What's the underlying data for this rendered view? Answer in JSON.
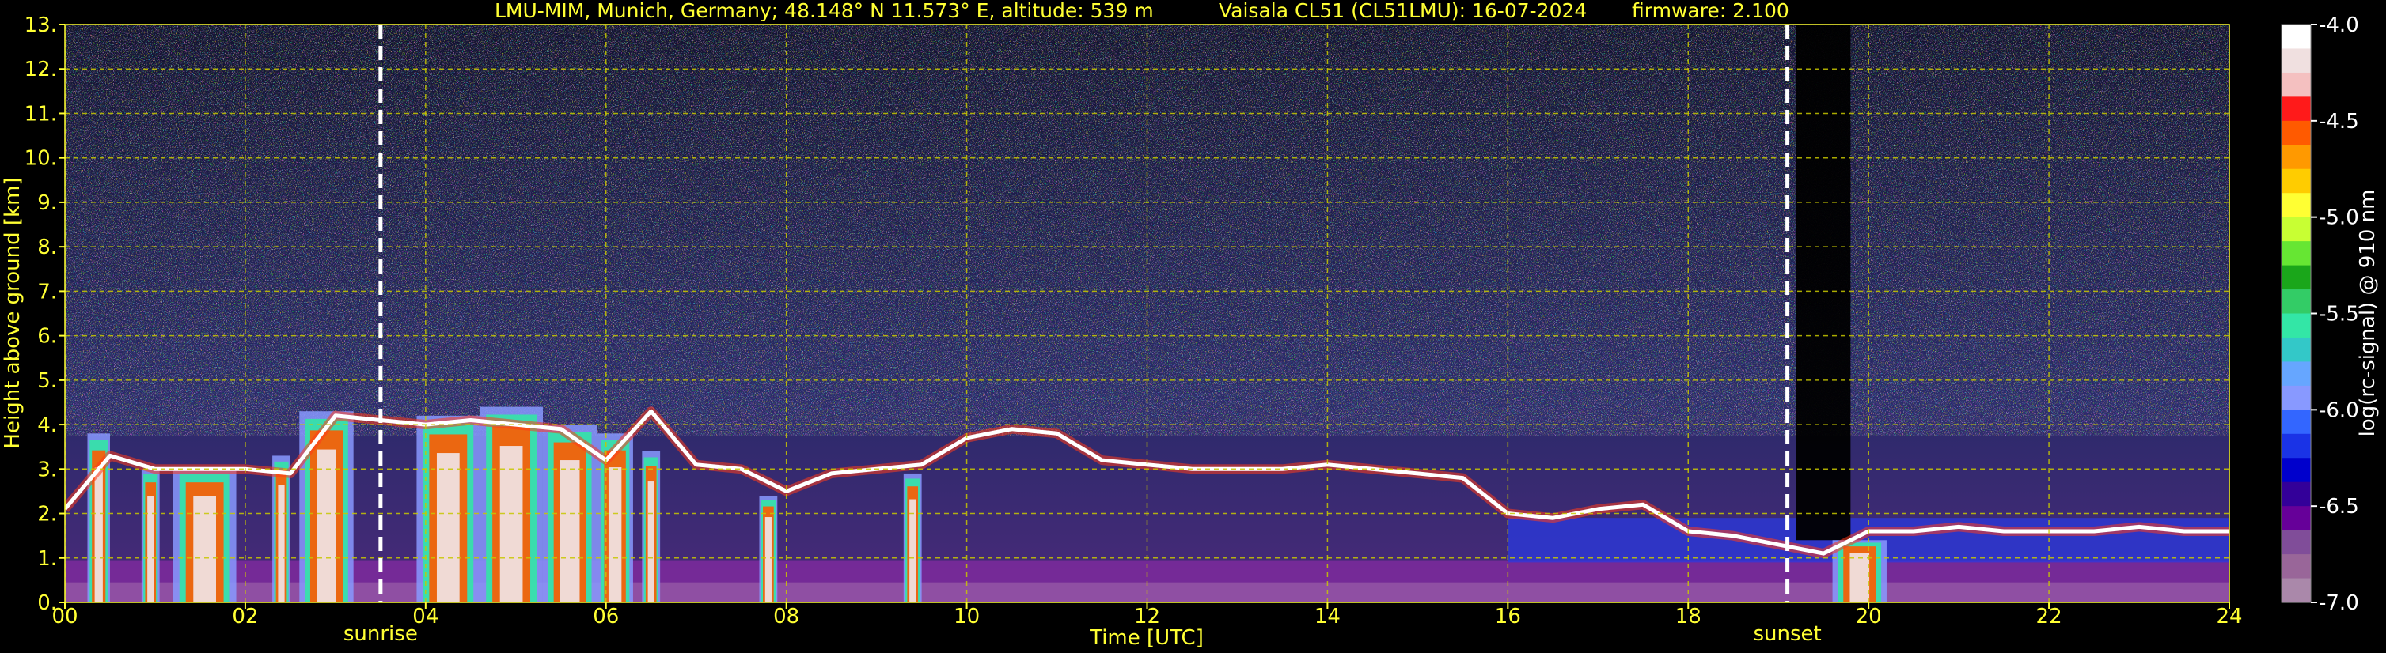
{
  "header": {
    "site": "LMU-MIM, Munich, Germany; 48.148° N 11.573° E, altitude: 539 m",
    "instrument": "Vaisala CL51 (CL51LMU): 16-07-2024",
    "firmware": "firmware: 2.100"
  },
  "colors": {
    "text": "#ffff33",
    "grid": "#c8c800",
    "background": "#000000",
    "marker": "#ffffff"
  },
  "chart_data": {
    "type": "heatmap",
    "title": "",
    "xlabel": "Time [UTC]",
    "ylabel": "Height above ground [km]",
    "xlim": [
      0,
      24
    ],
    "ylim": [
      0,
      13
    ],
    "x_ticks": [
      "00",
      "02",
      "04",
      "06",
      "08",
      "10",
      "12",
      "14",
      "16",
      "18",
      "20",
      "22",
      "24"
    ],
    "x_tick_values": [
      0,
      2,
      4,
      6,
      8,
      10,
      12,
      14,
      16,
      18,
      20,
      22,
      24
    ],
    "y_ticks": [
      "0.",
      "1.",
      "2.",
      "3.",
      "4.",
      "5.",
      "6.",
      "7.",
      "8.",
      "9.",
      "10.",
      "11.",
      "12.",
      "13."
    ],
    "y_tick_values": [
      0,
      1,
      2,
      3,
      4,
      5,
      6,
      7,
      8,
      9,
      10,
      11,
      12,
      13
    ],
    "grid": true,
    "annotations": [
      {
        "label": "sunrise",
        "x": 3.5
      },
      {
        "label": "sunset",
        "x": 19.1
      }
    ],
    "colorbar": {
      "label": "log(rc-signal) @ 910 nm",
      "range": [
        -7.0,
        -4.0
      ],
      "ticks": [
        "-4.0",
        "-4.5",
        "-5.0",
        "-5.5",
        "-6.0",
        "-6.5",
        "-7.0"
      ],
      "tick_values": [
        -4.0,
        -4.5,
        -5.0,
        -5.5,
        -6.0,
        -6.5,
        -7.0
      ],
      "colors": [
        "#ffffff",
        "#f0e0e0",
        "#f4c0c0",
        "#ff1a1a",
        "#ff5a00",
        "#ff9900",
        "#ffcc00",
        "#ffff33",
        "#c8ff33",
        "#66e633",
        "#1aa61a",
        "#33cc66",
        "#33e6a6",
        "#33c8c8",
        "#66a6ff",
        "#8899ff",
        "#3366ff",
        "#1a33e6",
        "#0000cc",
        "#330099",
        "#660099",
        "#804d99",
        "#996699",
        "#aa88aa"
      ]
    },
    "cloud_base_layer": {
      "x": [
        0.0,
        0.5,
        1.0,
        1.5,
        2.0,
        2.5,
        3.0,
        3.5,
        4.0,
        4.5,
        5.0,
        5.5,
        6.0,
        6.5,
        7.0,
        7.5,
        8.0,
        8.5,
        9.0,
        9.5,
        10.0,
        10.5,
        11.0,
        11.5,
        12.0,
        12.5,
        13.0,
        13.5,
        14.0,
        14.5,
        15.0,
        15.5,
        16.0,
        16.5,
        17.0,
        17.5,
        18.0,
        18.5,
        19.0,
        19.5,
        20.0,
        20.5,
        21.0,
        21.5,
        22.0,
        22.5,
        23.0,
        23.5,
        24.0
      ],
      "height_km": [
        2.1,
        3.3,
        3.0,
        3.0,
        3.0,
        2.9,
        4.2,
        4.1,
        4.0,
        4.1,
        4.0,
        3.9,
        3.2,
        4.3,
        3.1,
        3.0,
        2.5,
        2.9,
        3.0,
        3.1,
        3.7,
        3.9,
        3.8,
        3.2,
        3.1,
        3.0,
        3.0,
        3.0,
        3.1,
        3.0,
        2.9,
        2.8,
        2.0,
        1.9,
        2.1,
        2.2,
        1.6,
        1.5,
        1.3,
        1.1,
        1.6,
        1.6,
        1.7,
        1.6,
        1.6,
        1.6,
        1.7,
        1.6,
        1.6
      ]
    }
  }
}
